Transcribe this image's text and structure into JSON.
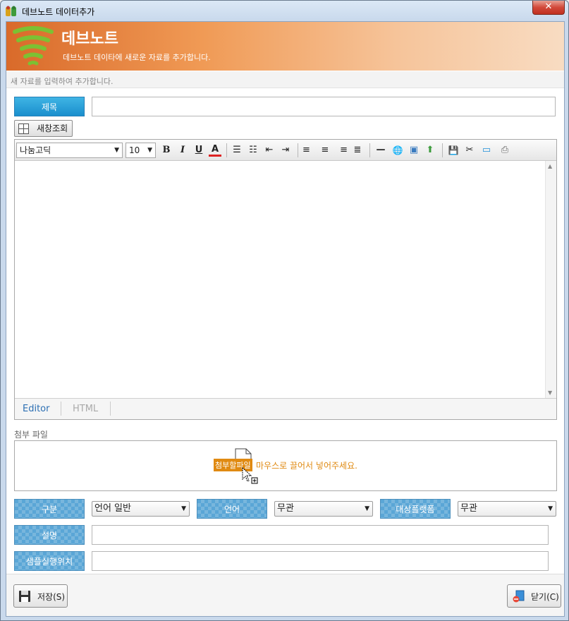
{
  "window": {
    "title": "데브노트 데이터추가",
    "close_glyph": "✕"
  },
  "banner": {
    "title": "데브노트",
    "subtitle": "데브노트 데이타에 새로운 자료를 추가합니다."
  },
  "hint": "새 자료를 입력하여 추가합니다.",
  "title_field": {
    "label": "제목",
    "value": ""
  },
  "preview_button": {
    "label": "새창조회"
  },
  "editor": {
    "font_family": "나눔고딕",
    "font_size": "10",
    "toolbar_icons": [
      "bold-icon",
      "italic-icon",
      "underline-icon",
      "font-color-icon",
      "ordered-list-icon",
      "unordered-list-icon",
      "outdent-icon",
      "indent-icon",
      "align-left-icon",
      "align-center-icon",
      "align-right-icon",
      "align-justify-icon",
      "horizontal-rule-icon",
      "link-icon",
      "image-icon",
      "insert-icon",
      "save-icon",
      "cut-icon",
      "screen-icon",
      "print-icon"
    ],
    "toolbar_glyphs": {
      "bold": "B",
      "italic": "I",
      "underline": "U",
      "font_color": "A",
      "ordered_list": "☰",
      "unordered_list": "☷",
      "outdent": "⇤",
      "indent": "⇥",
      "align_left": "≡",
      "align_center": "≡",
      "align_right": "≡",
      "align_justify": "≣",
      "hr": "—",
      "link": "🌐",
      "image": "▣",
      "insert": "⬆",
      "save": "💾",
      "cut": "✂",
      "screen": "▭",
      "print": "⎙"
    },
    "tabs": [
      {
        "label": "Editor",
        "active": true
      },
      {
        "label": "HTML",
        "active": false
      }
    ],
    "scroll_up": "▲",
    "scroll_down": "▼"
  },
  "attach": {
    "label": "첨부 파일",
    "tag": "첨부할파일",
    "message": "마우스로 끌어서 넣어주세요."
  },
  "fields": {
    "category": {
      "label": "구분",
      "value": "언어 일반"
    },
    "language": {
      "label": "언어",
      "value": "무관"
    },
    "platform": {
      "label": "대상플랫폼",
      "value": "무관"
    },
    "description": {
      "label": "설명",
      "value": ""
    },
    "sample_path": {
      "label": "샘플실행위치",
      "value": ""
    }
  },
  "buttons": {
    "save": "저장(S)",
    "close": "닫기(C)"
  },
  "dropdown_arrow": "▼",
  "colors": {
    "accent_blue": "#1a8fcd",
    "banner_orange": "#f09a55",
    "drop_orange": "#e08a12"
  }
}
